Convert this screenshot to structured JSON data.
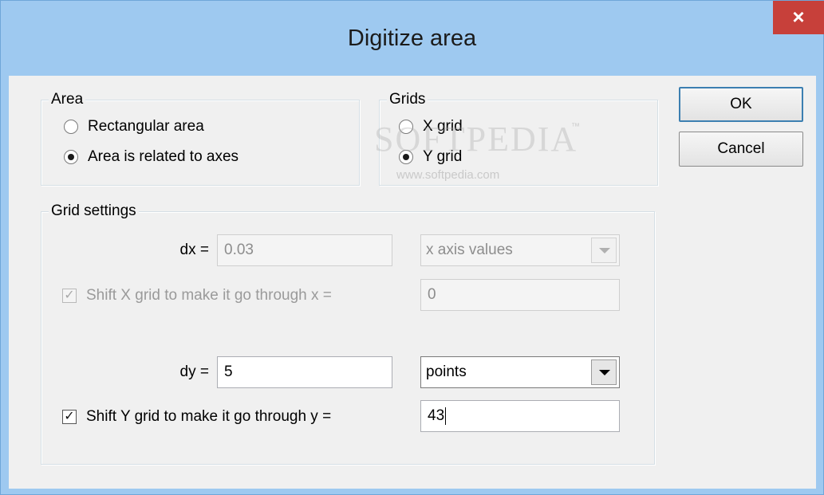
{
  "window": {
    "title": "Digitize area",
    "close_glyph": "×"
  },
  "area_group": {
    "title": "Area",
    "options": [
      {
        "label": "Rectangular area",
        "selected": false
      },
      {
        "label": "Area is related to axes",
        "selected": true
      }
    ]
  },
  "grids_group": {
    "title": "Grids",
    "options": [
      {
        "label": "X grid",
        "selected": false
      },
      {
        "label": "Y grid",
        "selected": true
      }
    ]
  },
  "grid_settings": {
    "title": "Grid settings",
    "dx_label": "dx =",
    "dx_value": "0.03",
    "dx_unit": "x axis values",
    "shift_x_label": "Shift X grid to make it go through x =",
    "shift_x_checked": true,
    "shift_x_value": "0",
    "dy_label": "dy =",
    "dy_value": "5",
    "dy_unit": "points",
    "shift_y_label": "Shift Y grid to make it go through y =",
    "shift_y_checked": true,
    "shift_y_value": "43"
  },
  "buttons": {
    "ok_label": "OK",
    "cancel_label": "Cancel"
  },
  "watermark": {
    "logo_text": "SOFTPEDIA",
    "tm": "™",
    "url": "www.softpedia.com"
  },
  "icons": {
    "close": "close-icon",
    "dropdown": "chevron-down-icon",
    "check": "checkmark-icon"
  },
  "colors": {
    "titlebar": "#9ec9f0",
    "close_button": "#c7403a",
    "dialog_bg": "#f0f0f0",
    "default_button_border": "#3c7fb1"
  }
}
